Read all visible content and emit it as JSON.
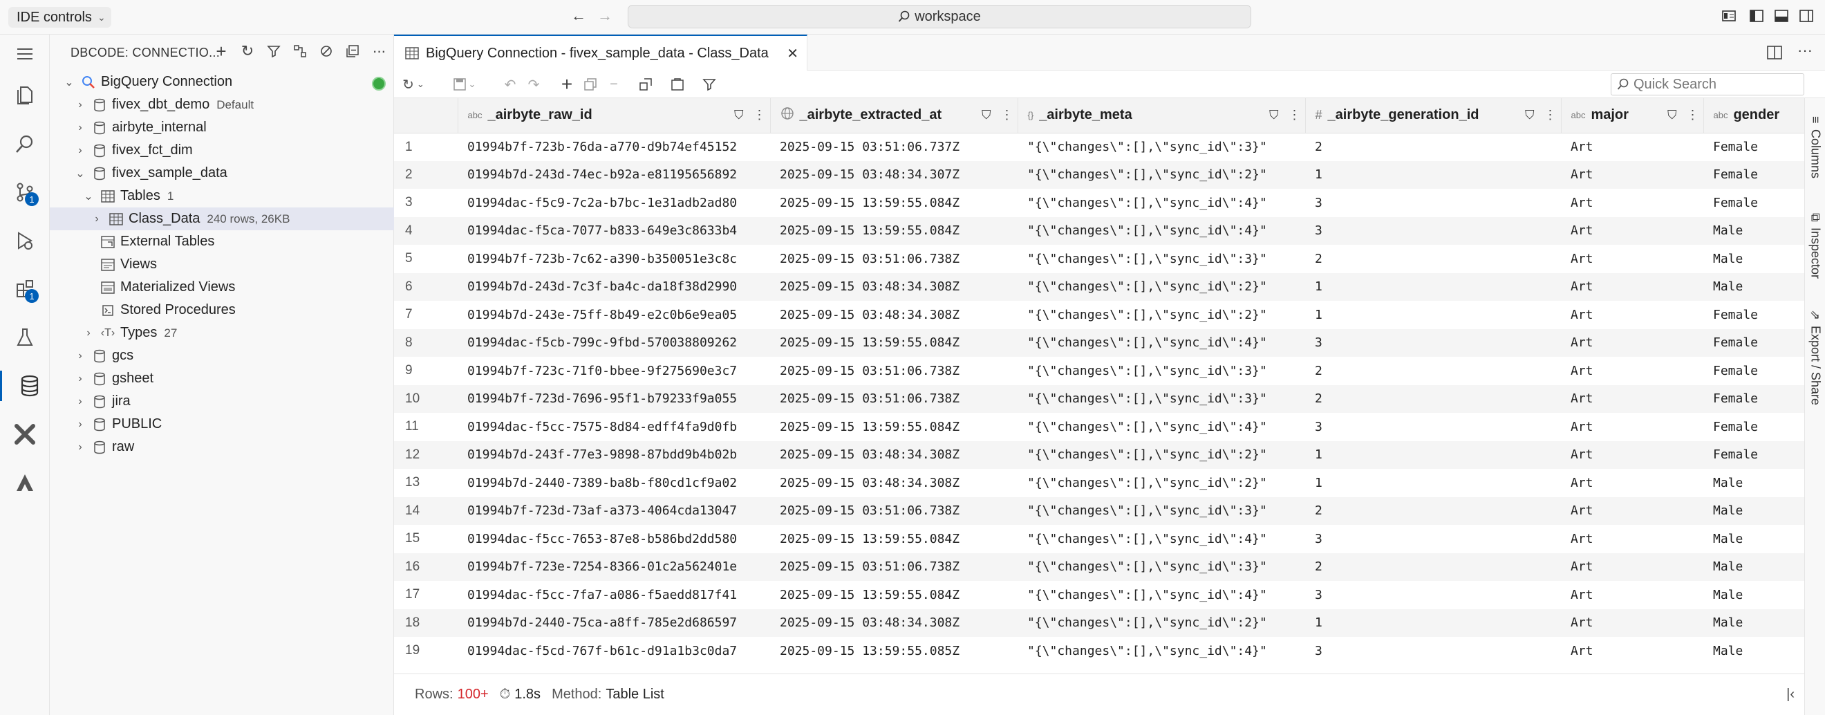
{
  "titlebar": {
    "ide_controls": "IDE controls",
    "command_center": "workspace"
  },
  "sidebar": {
    "title": "DBCODE: CONNECTIO...",
    "connection": "BigQuery Connection",
    "items": [
      {
        "label": "fivex_dbt_demo",
        "meta": "Default"
      },
      {
        "label": "airbyte_internal",
        "meta": ""
      },
      {
        "label": "fivex_fct_dim",
        "meta": ""
      },
      {
        "label": "fivex_sample_data",
        "meta": ""
      },
      {
        "label": "Tables",
        "meta": "1"
      },
      {
        "label": "Class_Data",
        "meta": "240 rows, 26KB"
      },
      {
        "label": "External Tables",
        "meta": ""
      },
      {
        "label": "Views",
        "meta": ""
      },
      {
        "label": "Materialized Views",
        "meta": ""
      },
      {
        "label": "Stored Procedures",
        "meta": ""
      },
      {
        "label": "Types",
        "meta": "27"
      },
      {
        "label": "gcs",
        "meta": ""
      },
      {
        "label": "gsheet",
        "meta": ""
      },
      {
        "label": "jira",
        "meta": ""
      },
      {
        "label": "PUBLIC",
        "meta": ""
      },
      {
        "label": "raw",
        "meta": ""
      }
    ]
  },
  "activity_badges": {
    "scm": "1",
    "extensions": "1"
  },
  "editor": {
    "tab_title": "BigQuery Connection - fivex_sample_data - Class_Data",
    "quick_search_placeholder": "Quick Search",
    "columns": [
      {
        "type": "abc",
        "name": "_airbyte_raw_id"
      },
      {
        "type": "",
        "name": "_airbyte_extracted_at"
      },
      {
        "type": "{}",
        "name": "_airbyte_meta"
      },
      {
        "type": "#",
        "name": "_airbyte_generation_id"
      },
      {
        "type": "abc",
        "name": "major"
      },
      {
        "type": "abc",
        "name": "gender"
      }
    ],
    "rows": [
      [
        "1",
        "01994b7f-723b-76da-a770-d9b74ef45152",
        "2025-09-15 03:51:06.737Z",
        "\"{\\\"changes\\\":[],\\\"sync_id\\\":3}\"",
        "2",
        "Art",
        "Female"
      ],
      [
        "2",
        "01994b7d-243d-74ec-b92a-e81195656892",
        "2025-09-15 03:48:34.307Z",
        "\"{\\\"changes\\\":[],\\\"sync_id\\\":2}\"",
        "1",
        "Art",
        "Female"
      ],
      [
        "3",
        "01994dac-f5c9-7c2a-b7bc-1e31adb2ad80",
        "2025-09-15 13:59:55.084Z",
        "\"{\\\"changes\\\":[],\\\"sync_id\\\":4}\"",
        "3",
        "Art",
        "Female"
      ],
      [
        "4",
        "01994dac-f5ca-7077-b833-649e3c8633b4",
        "2025-09-15 13:59:55.084Z",
        "\"{\\\"changes\\\":[],\\\"sync_id\\\":4}\"",
        "3",
        "Art",
        "Male"
      ],
      [
        "5",
        "01994b7f-723b-7c62-a390-b350051e3c8c",
        "2025-09-15 03:51:06.738Z",
        "\"{\\\"changes\\\":[],\\\"sync_id\\\":3}\"",
        "2",
        "Art",
        "Male"
      ],
      [
        "6",
        "01994b7d-243d-7c3f-ba4c-da18f38d2990",
        "2025-09-15 03:48:34.308Z",
        "\"{\\\"changes\\\":[],\\\"sync_id\\\":2}\"",
        "1",
        "Art",
        "Male"
      ],
      [
        "7",
        "01994b7d-243e-75ff-8b49-e2c0b6e9ea05",
        "2025-09-15 03:48:34.308Z",
        "\"{\\\"changes\\\":[],\\\"sync_id\\\":2}\"",
        "1",
        "Art",
        "Female"
      ],
      [
        "8",
        "01994dac-f5cb-799c-9fbd-570038809262",
        "2025-09-15 13:59:55.084Z",
        "\"{\\\"changes\\\":[],\\\"sync_id\\\":4}\"",
        "3",
        "Art",
        "Female"
      ],
      [
        "9",
        "01994b7f-723c-71f0-bbee-9f275690e3c7",
        "2025-09-15 03:51:06.738Z",
        "\"{\\\"changes\\\":[],\\\"sync_id\\\":3}\"",
        "2",
        "Art",
        "Female"
      ],
      [
        "10",
        "01994b7f-723d-7696-95f1-b79233f9a055",
        "2025-09-15 03:51:06.738Z",
        "\"{\\\"changes\\\":[],\\\"sync_id\\\":3}\"",
        "2",
        "Art",
        "Female"
      ],
      [
        "11",
        "01994dac-f5cc-7575-8d84-edff4fa9d0fb",
        "2025-09-15 13:59:55.084Z",
        "\"{\\\"changes\\\":[],\\\"sync_id\\\":4}\"",
        "3",
        "Art",
        "Female"
      ],
      [
        "12",
        "01994b7d-243f-77e3-9898-87bdd9b4b02b",
        "2025-09-15 03:48:34.308Z",
        "\"{\\\"changes\\\":[],\\\"sync_id\\\":2}\"",
        "1",
        "Art",
        "Female"
      ],
      [
        "13",
        "01994b7d-2440-7389-ba8b-f80cd1cf9a02",
        "2025-09-15 03:48:34.308Z",
        "\"{\\\"changes\\\":[],\\\"sync_id\\\":2}\"",
        "1",
        "Art",
        "Male"
      ],
      [
        "14",
        "01994b7f-723d-73af-a373-4064cda13047",
        "2025-09-15 03:51:06.738Z",
        "\"{\\\"changes\\\":[],\\\"sync_id\\\":3}\"",
        "2",
        "Art",
        "Male"
      ],
      [
        "15",
        "01994dac-f5cc-7653-87e8-b586bd2dd580",
        "2025-09-15 13:59:55.084Z",
        "\"{\\\"changes\\\":[],\\\"sync_id\\\":4}\"",
        "3",
        "Art",
        "Male"
      ],
      [
        "16",
        "01994b7f-723e-7254-8366-01c2a562401e",
        "2025-09-15 03:51:06.738Z",
        "\"{\\\"changes\\\":[],\\\"sync_id\\\":3}\"",
        "2",
        "Art",
        "Male"
      ],
      [
        "17",
        "01994dac-f5cc-7fa7-a086-f5aedd817f41",
        "2025-09-15 13:59:55.084Z",
        "\"{\\\"changes\\\":[],\\\"sync_id\\\":4}\"",
        "3",
        "Art",
        "Male"
      ],
      [
        "18",
        "01994b7d-2440-75ca-a8ff-785e2d686597",
        "2025-09-15 03:48:34.308Z",
        "\"{\\\"changes\\\":[],\\\"sync_id\\\":2}\"",
        "1",
        "Art",
        "Male"
      ],
      [
        "19",
        "01994dac-f5cd-767f-b61c-d91a1b3c0da7",
        "2025-09-15 13:59:55.085Z",
        "\"{\\\"changes\\\":[],\\\"sync_id\\\":4}\"",
        "3",
        "Art",
        "Male"
      ]
    ]
  },
  "status": {
    "rows_label": "Rows:",
    "rows_value": "100+",
    "time": "1.8s",
    "method_label": "Method:",
    "method_value": "Table List"
  },
  "right_panel": {
    "columns": "Columns",
    "inspector": "Inspector",
    "export": "Export / Share"
  },
  "colors": {
    "accent": "#005fb8",
    "status_red": "#d4272c",
    "connected": "#3aa843"
  }
}
